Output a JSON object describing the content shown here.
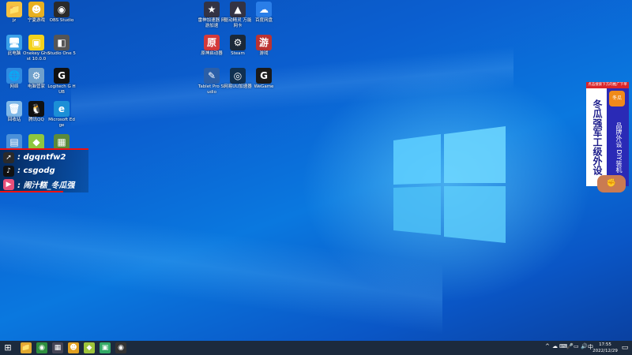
{
  "colors": {
    "taskbar": "#1c2a3d",
    "wallpaper_base": "#0a63d2",
    "overlay_red": "#e11111",
    "ad_red": "#d9252a",
    "ad_blue": "#2a2ab6"
  },
  "desktop_icons": [
    {
      "id": "folder",
      "glyph": "📁",
      "bg": "#f5c140",
      "label": "jz"
    },
    {
      "id": "app-yellow",
      "glyph": "☻",
      "bg": "#e8b020",
      "label": "宁夏游戏"
    },
    {
      "id": "obs",
      "glyph": "◉",
      "bg": "#2a2a2a",
      "label": "OBS Studio"
    },
    {
      "id": "this-pc",
      "glyph": "🖥",
      "bg": "#3aa0e8",
      "label": "此电脑"
    },
    {
      "id": "onekey",
      "glyph": "▣",
      "bg": "#f3d21c",
      "label": "Onekey Ghost 10.0.0"
    },
    {
      "id": "obs-alt",
      "glyph": "◧",
      "bg": "#555555",
      "label": "Studio One 5"
    },
    {
      "id": "network",
      "glyph": "🌐",
      "bg": "#2f8ae0",
      "label": "网络"
    },
    {
      "id": "computer-manager",
      "glyph": "⚙",
      "bg": "#6fa0cc",
      "label": "电脑管家"
    },
    {
      "id": "logitech",
      "glyph": "G",
      "bg": "#111111",
      "label": "Logitech G HUB"
    },
    {
      "id": "recycle-bin",
      "glyph": "🗑",
      "bg": "#7fb8e8",
      "label": "回收站"
    },
    {
      "id": "qq",
      "glyph": "🐧",
      "bg": "#111111",
      "label": "腾讯QQ"
    },
    {
      "id": "edge",
      "glyph": "e",
      "bg": "#1c8fd6",
      "label": "Microsoft Edge"
    },
    {
      "id": "control",
      "glyph": "▤",
      "bg": "#4a90d9",
      "label": ""
    },
    {
      "id": "greenapp",
      "glyph": "◆",
      "bg": "#8ec63f",
      "label": ""
    },
    {
      "id": "minecraft",
      "glyph": "▦",
      "bg": "#5b8a3a",
      "label": ""
    },
    {
      "id": "game-booster",
      "glyph": "★",
      "bg": "#334",
      "label": "雷神加速器 网游加速"
    },
    {
      "id": "driver",
      "glyph": "▲",
      "bg": "#334",
      "label": "驱动精灵 万能网卡"
    },
    {
      "id": "baidu-netdisk",
      "glyph": "☁",
      "bg": "#2a7ee8",
      "label": "百度网盘"
    },
    {
      "id": "genshin",
      "glyph": "原",
      "bg": "#d43a3a",
      "label": "原神启动器"
    },
    {
      "id": "steam",
      "glyph": "⚙",
      "bg": "#1b2838",
      "label": "Steam"
    },
    {
      "id": "game-app",
      "glyph": "游",
      "bg": "#b33",
      "label": "游戏"
    },
    {
      "id": "pen",
      "glyph": "✎",
      "bg": "#2b5fa8",
      "label": "Tablet Pro Studio"
    },
    {
      "id": "speedtest",
      "glyph": "◎",
      "bg": "#103050",
      "label": "网易UU加速器"
    },
    {
      "id": "wegame",
      "glyph": "G",
      "bg": "#1a1a1a",
      "label": "WeGame"
    }
  ],
  "overlay": {
    "rows": [
      {
        "icon": "➚",
        "icon_bg": "#2a2a2a",
        "text": ": dgqntfw2"
      },
      {
        "icon": "♪",
        "icon_bg": "#111111",
        "text": ": csgodg"
      },
      {
        "icon": "▶",
        "icon_bg": "#ea4f7a",
        "text": ": 闹汁糕_冬瓜强"
      }
    ]
  },
  "ad": {
    "top_text": "点击搜索下方的推广下单",
    "left_text": "冬瓜强军工级外设",
    "logo_text": "冬瓜",
    "right_text": "品牌外设 DIY装机"
  },
  "taskbar": {
    "start_glyph": "⊞",
    "apps": [
      {
        "id": "file-explorer",
        "glyph": "📁",
        "bg": "#e0a82e"
      },
      {
        "id": "chrome",
        "glyph": "◉",
        "bg": "#2f8f3f"
      },
      {
        "id": "game",
        "glyph": "▦",
        "bg": "#445"
      },
      {
        "id": "face-app",
        "glyph": "☻",
        "bg": "#e0a020"
      },
      {
        "id": "green-app",
        "glyph": "◆",
        "bg": "#9ec43a"
      },
      {
        "id": "edge-tab",
        "glyph": "▣",
        "bg": "#3a6"
      },
      {
        "id": "obs-running",
        "glyph": "◉",
        "bg": "#333"
      }
    ],
    "tray": [
      "^",
      "☁",
      "⌨",
      "🎤",
      "▭",
      "🔊",
      "中"
    ],
    "time": "17:55",
    "date": "2022/12/29",
    "notification_glyph": "▭"
  }
}
